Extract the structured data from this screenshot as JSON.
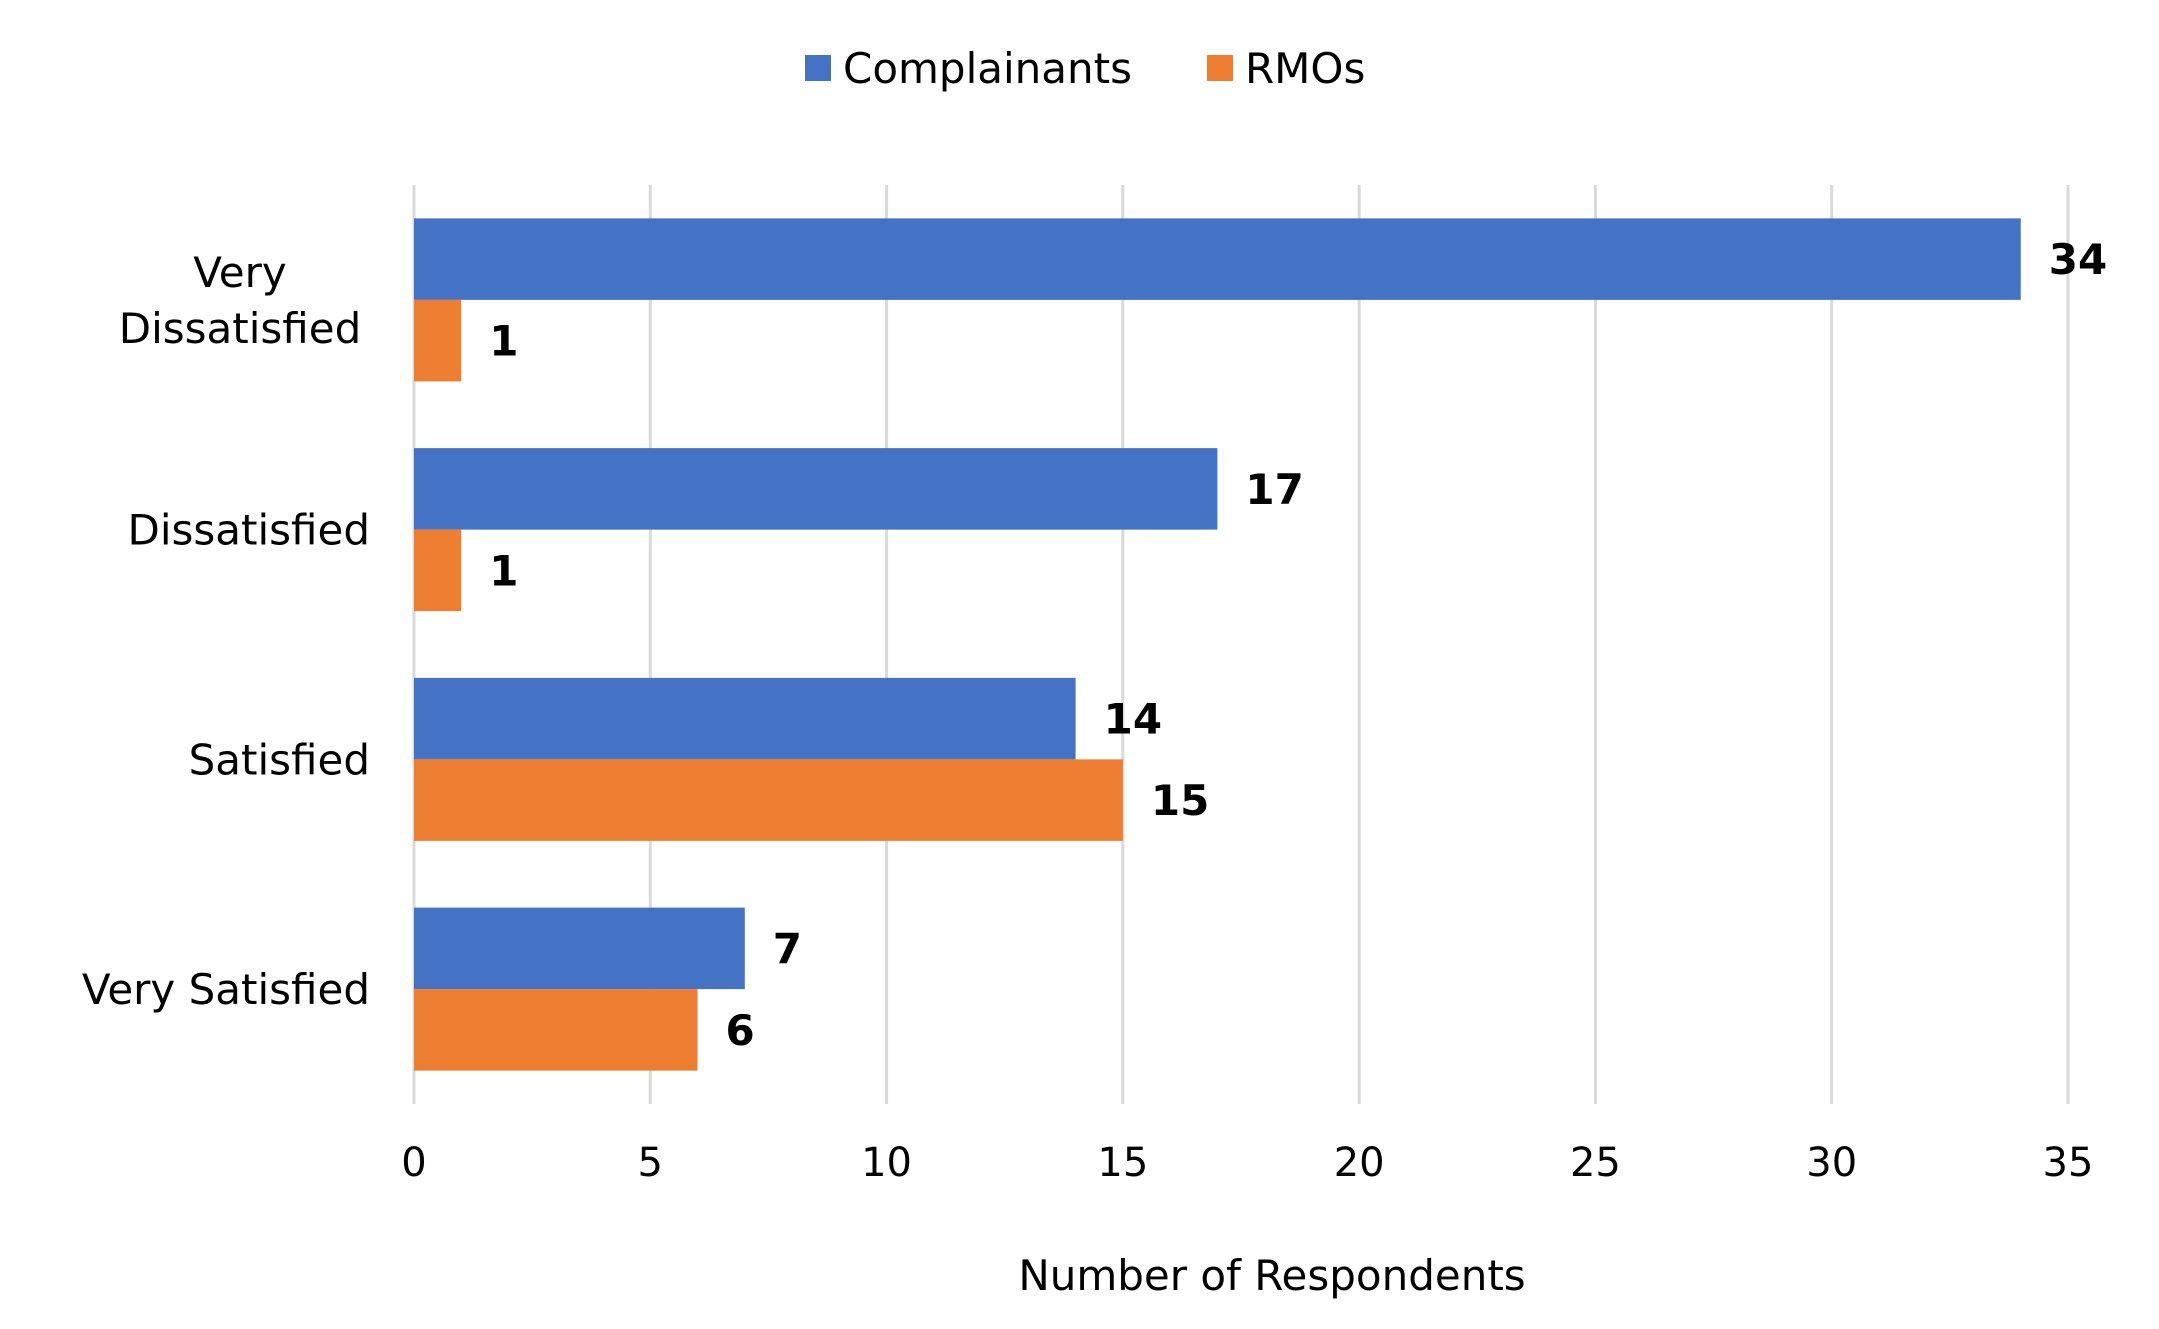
{
  "chart_data": {
    "type": "bar",
    "orientation": "horizontal",
    "title": "",
    "categories": [
      "Very Dissatisfied",
      "Dissatisfied",
      "Satisfied",
      "Very Satisfied"
    ],
    "category_lines": [
      [
        "Very",
        "Dissatisfied"
      ],
      [
        "Dissatisfied"
      ],
      [
        "Satisfied"
      ],
      [
        "Very Satisfied"
      ]
    ],
    "series": [
      {
        "name": "Complainants",
        "color": "#4472C4",
        "values": [
          34,
          17,
          14,
          7
        ]
      },
      {
        "name": "RMOs",
        "color": "#ED7D31",
        "values": [
          1,
          1,
          15,
          6
        ]
      }
    ],
    "xlabel": "Number of Respondents",
    "ylabel": "",
    "xlim": [
      0,
      35
    ],
    "xticks": [
      0,
      5,
      10,
      15,
      20,
      25,
      30,
      35
    ],
    "grid": "vertical",
    "grid_color": "#D9D9D9",
    "legend_position": "top-center",
    "data_labels": true
  }
}
